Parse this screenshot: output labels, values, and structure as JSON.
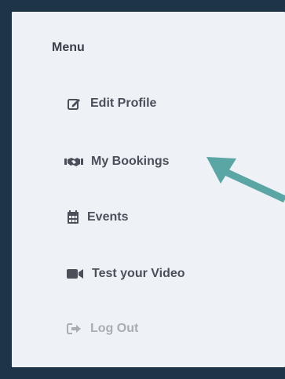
{
  "menu": {
    "title": "Menu",
    "items": [
      {
        "label": "Edit Profile",
        "icon": "edit-icon"
      },
      {
        "label": "My Bookings",
        "icon": "handshake-icon"
      },
      {
        "label": "Events",
        "icon": "calendar-icon"
      },
      {
        "label": "Test your Video",
        "icon": "video-camera-icon"
      },
      {
        "label": "Log Out",
        "icon": "sign-out-icon",
        "muted": true
      }
    ]
  },
  "colors": {
    "background": "#1e3447",
    "panel": "#eef1f5",
    "text": "#4a4f5a",
    "muted_text": "#a9adb4",
    "arrow": "#5aa6a5"
  }
}
